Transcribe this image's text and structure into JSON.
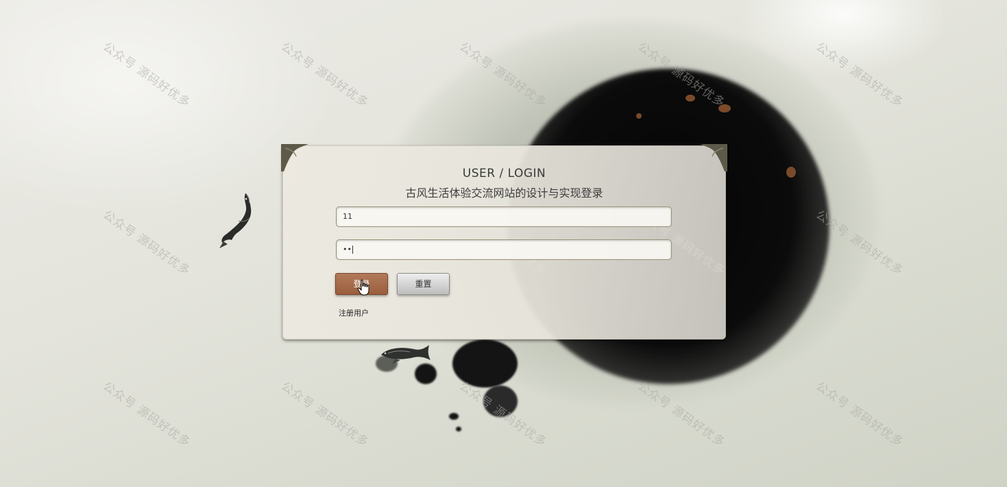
{
  "login": {
    "title_en": "USER / LOGIN",
    "title_cn": "古风生活体验交流网站的设计与实现登录",
    "username_value": "11",
    "password_value": "••",
    "login_label": "登录",
    "reset_label": "重置",
    "register_label": "注册用户"
  },
  "watermark": {
    "text": "公众号 源码好优多"
  },
  "colors": {
    "login_button": "#a86a4a",
    "reset_button": "#d4d4d4",
    "ink": "#0b0b0b"
  }
}
